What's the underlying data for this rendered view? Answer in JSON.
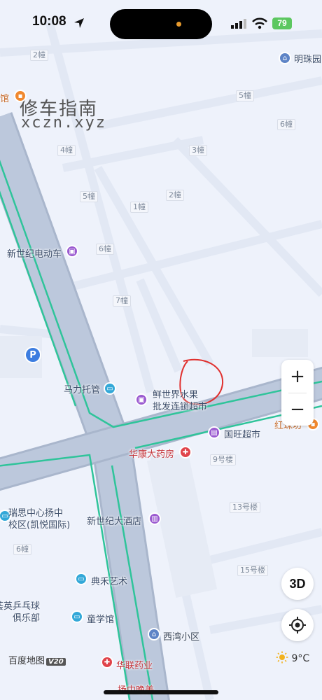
{
  "status_bar": {
    "time": "10:08",
    "battery": "79"
  },
  "watermark": {
    "line1": "修车指南",
    "line2": "xczn.xyz"
  },
  "buildings": [
    "2幢",
    "5幢",
    "6幢",
    "4幢",
    "3幢",
    "5幢",
    "2幢",
    "1幢",
    "6幢",
    "7幢",
    "9号楼",
    "13号楼",
    "6幢",
    "15号楼"
  ],
  "pois": {
    "mingzhu": "明珠园",
    "guan": "馆",
    "xinshiji_dd": "新世纪电动车",
    "mali": "马力托管",
    "xianshijie_1": "鲜世界水果",
    "xianshijie_2": "批发连锁超市",
    "guowang": "国旺超市",
    "hongzhu": "红珠坊",
    "huakang": "华康大药房",
    "ruisi_1": "瑞思中心扬中",
    "ruisi_2": "校区(凯悦国际)",
    "xinshiji_hotel": "新世纪大酒店",
    "dianhe": "典禾艺术",
    "pingpong_1": "荟英乒乓球",
    "pingpong_2": "俱乐部",
    "tongxue": "童学馆",
    "xiwan": "西湾小区",
    "hualian": "华联药业",
    "bottom": "扬中晚美"
  },
  "controls": {
    "zoom_in": "+",
    "zoom_out": "−",
    "view_3d": "3D",
    "locate_icon": "crosshair-icon"
  },
  "brand": {
    "name": "百度地图",
    "version": "V20"
  },
  "weather": {
    "temp": "9°C",
    "icon": "sun-icon"
  },
  "colors": {
    "road": "#bcc8dc",
    "road_edge": "#a9b6cc",
    "green_line": "#2fc49a",
    "annotation": "#e0302e",
    "bg": "#eef2fb"
  }
}
